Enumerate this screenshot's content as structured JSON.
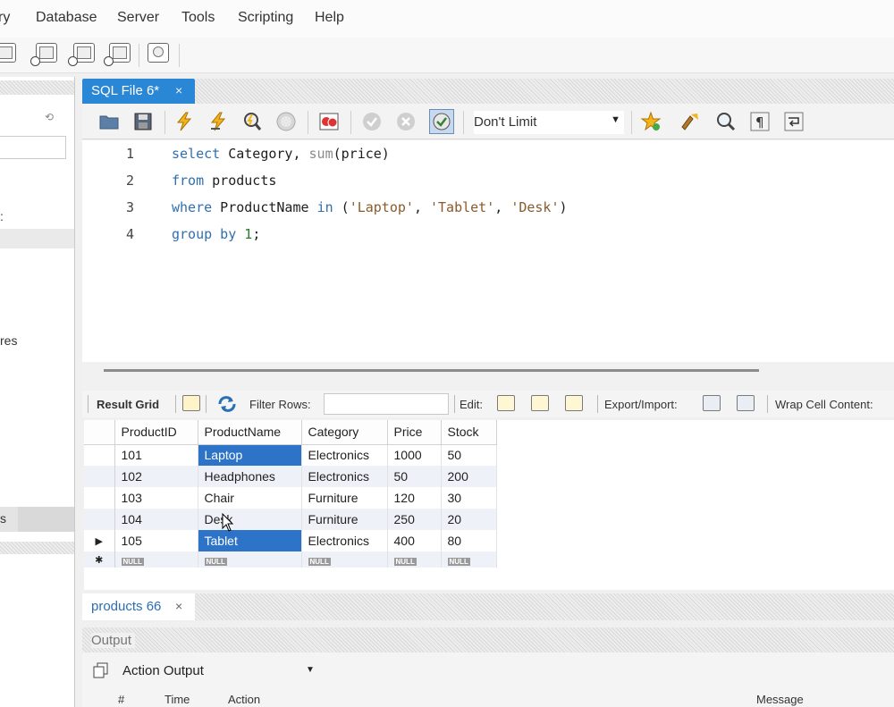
{
  "menu": [
    "ry",
    "Database",
    "Server",
    "Tools",
    "Scripting",
    "Help"
  ],
  "main_toolbar": {
    "icons": [
      "new-connection-icon",
      "open-model-icon",
      "query-table-icon",
      "schema-inspector-icon",
      "search-table-icon",
      "reconnect-icon"
    ]
  },
  "navigator": {
    "partial_labels": [
      ":",
      "res",
      "s"
    ]
  },
  "editor_tab": {
    "label": "SQL File 6*",
    "close": "×"
  },
  "sql_toolbar": {
    "limit_value": "Don't Limit"
  },
  "editor": {
    "lines": [
      {
        "no": "1",
        "tokens": [
          {
            "t": "select",
            "c": "kw"
          },
          {
            "t": " Category, "
          },
          {
            "t": "sum",
            "c": "fn"
          },
          {
            "t": "(price)"
          }
        ]
      },
      {
        "no": "2",
        "tokens": [
          {
            "t": "from",
            "c": "kw"
          },
          {
            "t": " products"
          }
        ]
      },
      {
        "no": "3",
        "tokens": [
          {
            "t": "where",
            "c": "kw"
          },
          {
            "t": " ProductName "
          },
          {
            "t": "in",
            "c": "kw"
          },
          {
            "t": " ("
          },
          {
            "t": "'Laptop'",
            "c": "str"
          },
          {
            "t": ", "
          },
          {
            "t": "'Tablet'",
            "c": "str"
          },
          {
            "t": ", "
          },
          {
            "t": "'Desk'",
            "c": "str"
          },
          {
            "t": ")"
          }
        ]
      },
      {
        "no": "4",
        "tokens": [
          {
            "t": "group by",
            "c": "kw"
          },
          {
            "t": " "
          },
          {
            "t": "1",
            "c": "num"
          },
          {
            "t": ";"
          }
        ]
      }
    ]
  },
  "result_toolbar": {
    "result_grid": "Result Grid",
    "filter_rows": "Filter Rows:",
    "edit": "Edit:",
    "export_import": "Export/Import:",
    "wrap": "Wrap Cell Content:"
  },
  "grid": {
    "columns": [
      "ProductID",
      "ProductName",
      "Category",
      "Price",
      "Stock"
    ],
    "rows": [
      {
        "indicator": "",
        "cells": [
          "101",
          "Laptop",
          "Electronics",
          "1000",
          "50"
        ],
        "selected": [
          1
        ]
      },
      {
        "indicator": "",
        "cells": [
          "102",
          "Headphones",
          "Electronics",
          "50",
          "200"
        ],
        "selected": []
      },
      {
        "indicator": "",
        "cells": [
          "103",
          "Chair",
          "Furniture",
          "120",
          "30"
        ],
        "selected": []
      },
      {
        "indicator": "",
        "cells": [
          "104",
          "Desk",
          "Furniture",
          "250",
          "20"
        ],
        "selected": []
      },
      {
        "indicator": "▶",
        "cells": [
          "105",
          "Tablet",
          "Electronics",
          "400",
          "80"
        ],
        "selected": [
          1
        ]
      }
    ],
    "new_row": {
      "indicator": "✱",
      "cells": [
        "NULL",
        "NULL",
        "NULL",
        "NULL",
        "NULL"
      ]
    }
  },
  "results_tab": {
    "label": "products 66",
    "close": "×"
  },
  "output": {
    "title": "Output",
    "mode": "Action Output",
    "columns": [
      "#",
      "Time",
      "Action",
      "Message"
    ]
  }
}
